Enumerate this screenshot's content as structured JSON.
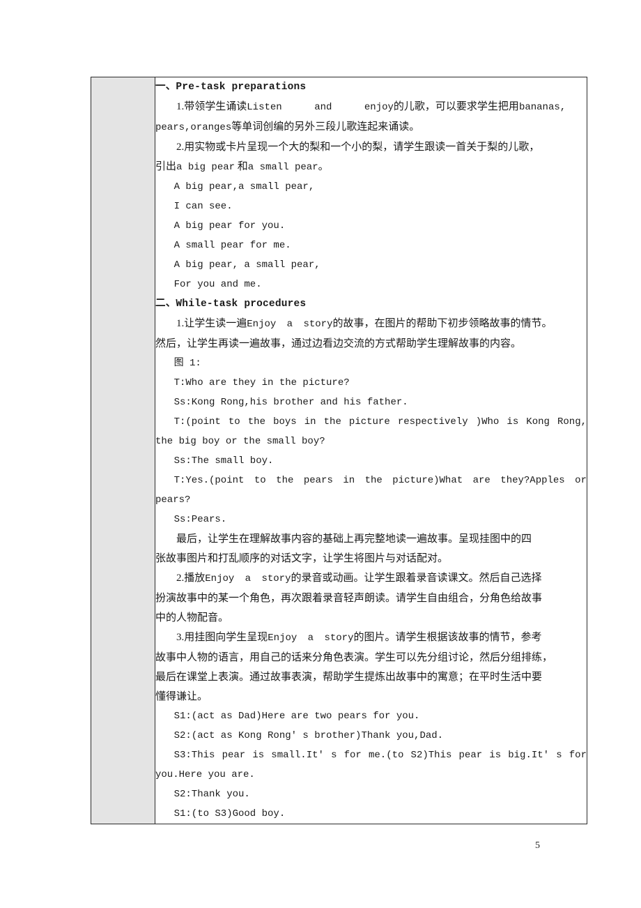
{
  "document": {
    "page_number": "5",
    "table": {
      "label_cell_text": "",
      "sections": [
        {
          "id": "pre-task",
          "heading": "一、Pre-task preparations",
          "items": [
            "1.带领学生诵读 Listen and enjoy 的儿歌，可以要求学生把用 bananas,pears,oranges 等单词创编的另外三段儿歌连起来诵读。",
            "2.用实物或卡片呈现一个大的梨和一个小的梨，请学生跟读一首关于梨的儿歌，引出 a big pear 和 a small pear。"
          ],
          "rhyme": [
            "A big pear,a small pear,",
            "I can see.",
            "A big pear for you.",
            "A small pear for me.",
            "A big pear, a small pear,",
            "For you and me."
          ]
        },
        {
          "id": "while-task",
          "heading": "二、While-task procedures",
          "items": [
            "1.让学生读一遍 Enjoy a story 的故事，在图片的帮助下初步领略故事的情节。然后，让学生再读一遍故事，通过边看边交流的方式帮助学生理解故事的内容。",
            "2.播放 Enjoy a story 的录音或动画。让学生跟着录音读课文。然后自己选择扮演故事中的某一个角色，再次跟着录音轻声朗读。请学生自由组合，分角色给故事中的人物配音。",
            "3.用挂图向学生呈现 Enjoy a story 的图片。请学生根据该故事的情节，参考故事中人物的语言，用自己的话来分角色表演。学生可以先分组讨论，然后分组排练，最后在课堂上表演。通过故事表演，帮助学生提炼出故事中的寓意；在平时生活中要懂得谦让。"
          ],
          "figure_label": "图 1:",
          "dialogue_1": [
            "T:Who are they in the picture?",
            "Ss:Kong Rong,his brother and his father.",
            "T:(point to the boys in the picture respectively )Who is Kong Rong, the big boy or the small boy?",
            "Ss:The small boy.",
            "T:Yes.(point to the pears in the picture)What are they?Apples or pears?",
            "Ss:Pears."
          ],
          "closing_note": "最后，让学生在理解故事内容的基础上再完整地读一遍故事。呈现挂图中的四张故事图片和打乱顺序的对话文字，让学生将图片与对话配对。",
          "dialogue_2": [
            "S1:(act as Dad)Here are two pears for you.",
            "S2:(act as Kong Rong' s brother)Thank you,Dad.",
            "S3:This pear is small.It' s for me.(to S2)This pear is big.It' s for you.Here you are.",
            "S2:Thank you.",
            "S1:(to S3)Good boy."
          ]
        }
      ]
    },
    "lines": {
      "p1_a_pre": "1.带领学生诵读",
      "p1_a_en1": "Listen",
      "p1_a_en2": "and",
      "p1_a_en3": "enjoy",
      "p1_a_mid": "的儿歌，可以要求学生把用",
      "p1_a_en4": "bananas,",
      "p1_b": "pears,oranges",
      "p1_b_tail": "等单词创编的另外三段儿歌连起来诵读。",
      "p2_a": "2.用实物或卡片呈现一个大的梨和一个小的梨，请学生跟读一首关于梨的儿歌，",
      "p2_b_pre": "引出",
      "p2_b_en1": "a big pear",
      "p2_b_mid": "和",
      "p2_b_en2": "a small pear",
      "p2_b_tail": "。",
      "w1_a_pre": "1.让学生读一遍",
      "w1_a_en": "Enjoy a story",
      "w1_a_tail": "的故事，在图片的帮助下初步领略故事的情节。",
      "w1_b": "然后，让学生再读一遍故事，通过边看边交流的方式帮助学生理解故事的内容。",
      "w_close_a": "最后，让学生在理解故事内容的基础上再完整地读一遍故事。呈现挂图中的四",
      "w_close_b": "张故事图片和打乱顺序的对话文字，让学生将图片与对话配对。",
      "w2_a_pre": "2.播放",
      "w2_a_en": "Enjoy a story",
      "w2_a_tail": "的录音或动画。让学生跟着录音读课文。然后自己选择",
      "w2_b": "扮演故事中的某一个角色，再次跟着录音轻声朗读。请学生自由组合，分角色给故事",
      "w2_c": "中的人物配音。",
      "w3_a_pre": "3.用挂图向学生呈现",
      "w3_a_en": "Enjoy a story",
      "w3_a_tail": "的图片。请学生根据该故事的情节，参考",
      "w3_b": "故事中人物的语言，用自己的话来分角色表演。学生可以先分组讨论，然后分组排练，",
      "w3_c": "最后在课堂上表演。通过故事表演，帮助学生提炼出故事中的寓意；在平时生活中要",
      "w3_d": "懂得谦让。",
      "d_t1": "T:Who are they in the picture?",
      "d_ss1": "Ss:Kong Rong,his brother and his father.",
      "d_t2_a": "T:(point to the boys in the picture respectively )Who is Kong Rong,",
      "d_t2_b": "the big boy or the small boy?",
      "d_ss2": "Ss:The small boy.",
      "d_t3_a": "T:Yes.(point to the pears in the picture)What are they?Apples or",
      "d_t3_b": "pears?",
      "d_ss3": "Ss:Pears.",
      "d_s1a": "S1:(act as Dad)Here are two pears for you.",
      "d_s2a": "S2:(act as Kong Rong' s brother)Thank you,Dad.",
      "d_s3a_a": "S3:This pear is small.It' s for me.(to S2)This pear is big.It' s for",
      "d_s3a_b": "you.Here you are.",
      "d_s2b": "S2:Thank you.",
      "d_s1b": "S1:(to S3)Good boy."
    }
  }
}
